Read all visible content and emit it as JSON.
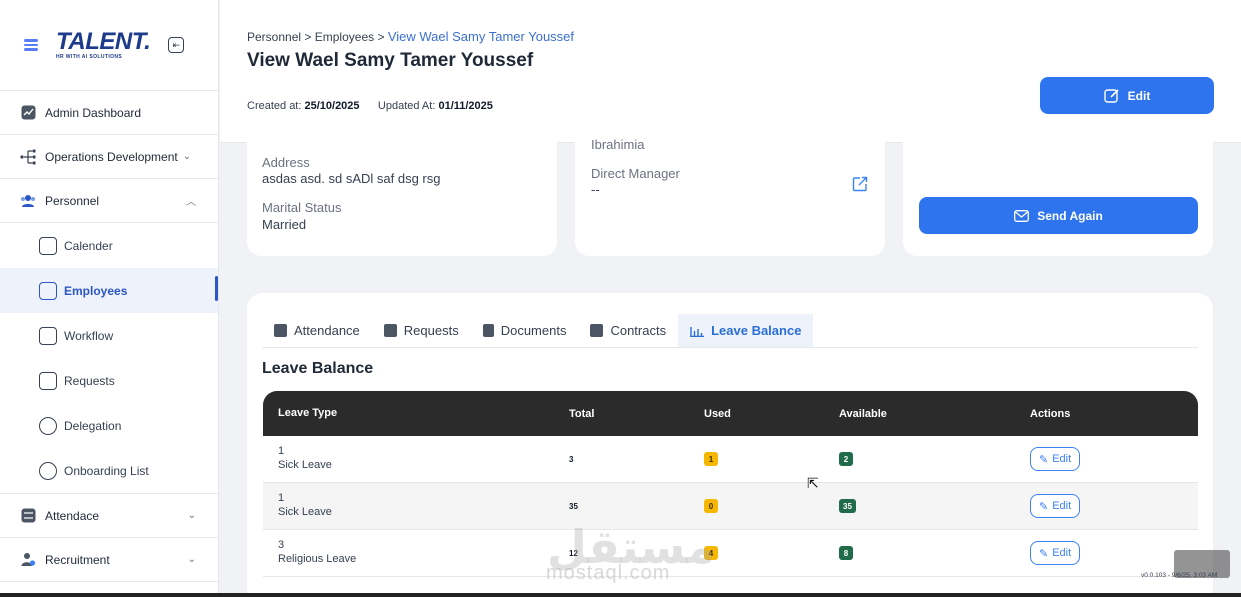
{
  "brand": {
    "logo": "TALENT.",
    "tagline": "HR WITH AI SOLUTIONS"
  },
  "sidebar": {
    "items": [
      {
        "label": "Admin Dashboard"
      },
      {
        "label": "Operations Development"
      },
      {
        "label": "Personnel"
      }
    ],
    "personnel_sub": [
      {
        "label": "Calender"
      },
      {
        "label": "Employees"
      },
      {
        "label": "Workflow"
      },
      {
        "label": "Requests"
      },
      {
        "label": "Delegation"
      },
      {
        "label": "Onboarding List"
      }
    ],
    "bottom_items": [
      {
        "label": "Attendace"
      },
      {
        "label": "Recruitment"
      }
    ]
  },
  "header": {
    "breadcrumb_1": "Personnel",
    "sep": ">",
    "breadcrumb_2": "Employees",
    "breadcrumb_3": "View Wael Samy Tamer Youssef",
    "title": "View Wael Samy Tamer Youssef",
    "created_label": "Created at:",
    "created_value": "25/10/2025",
    "updated_label": "Updated At:",
    "updated_value": "01/11/2025",
    "edit_label": "Edit"
  },
  "details": {
    "address_label": "Address",
    "address_value": "asdas asd. sd sADl saf dsg rsg",
    "marital_label": "Marital Status",
    "marital_value": "Married",
    "cut_text": "Ibrahimia",
    "manager_label": "Direct Manager",
    "manager_value": "--",
    "send_again_label": "Send Again"
  },
  "tabs": [
    {
      "label": "Attendance"
    },
    {
      "label": "Requests"
    },
    {
      "label": "Documents"
    },
    {
      "label": "Contracts"
    },
    {
      "label": "Leave Balance"
    }
  ],
  "leave_balance": {
    "title": "Leave Balance",
    "columns": [
      "Leave Type",
      "Total",
      "Used",
      "Available",
      "Actions"
    ],
    "rows": [
      {
        "id": "1",
        "type": "Sick Leave",
        "total": "3",
        "used": "1",
        "available": "2",
        "action": "Edit"
      },
      {
        "id": "1",
        "type": "Sick Leave",
        "total": "35",
        "used": "0",
        "available": "35",
        "action": "Edit"
      },
      {
        "id": "3",
        "type": "Religious Leave",
        "total": "12",
        "used": "4",
        "available": "8",
        "action": "Edit"
      }
    ]
  },
  "footer": {
    "version": "v0.0.103 - 9/6/25, 3:03 AM",
    "watermark": "مستقل",
    "watermark_latin": "mostaql.com"
  },
  "colors": {
    "primary": "#2f74ef",
    "active_text": "#2a56c6",
    "used_badge": "#f5b700",
    "available_badge": "#1f6b4a",
    "table_header": "#2b2b2b"
  }
}
